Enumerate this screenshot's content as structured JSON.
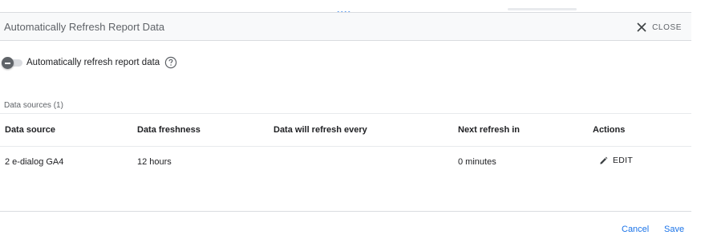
{
  "dialog": {
    "title": "Automatically Refresh Report Data",
    "close_label": "CLOSE",
    "toggle_label": "Automatically refresh report data",
    "toggle_on": false,
    "data_sources_count": "Data sources (1)",
    "table": {
      "columns": [
        "Data source",
        "Data freshness",
        "Data will refresh every",
        "Next refresh in",
        "Actions"
      ],
      "rows": [
        {
          "source": "2 e-dialog GA4",
          "freshness": "12 hours",
          "refresh_every": "",
          "next_refresh": "0 minutes",
          "action": "EDIT"
        }
      ]
    },
    "footer": {
      "cancel_label": "Cancel",
      "save_label": "Save"
    }
  },
  "colors": {
    "accent": "#1a73e8",
    "header_bg": "#f8f9fa",
    "divider": "#dadce0"
  }
}
